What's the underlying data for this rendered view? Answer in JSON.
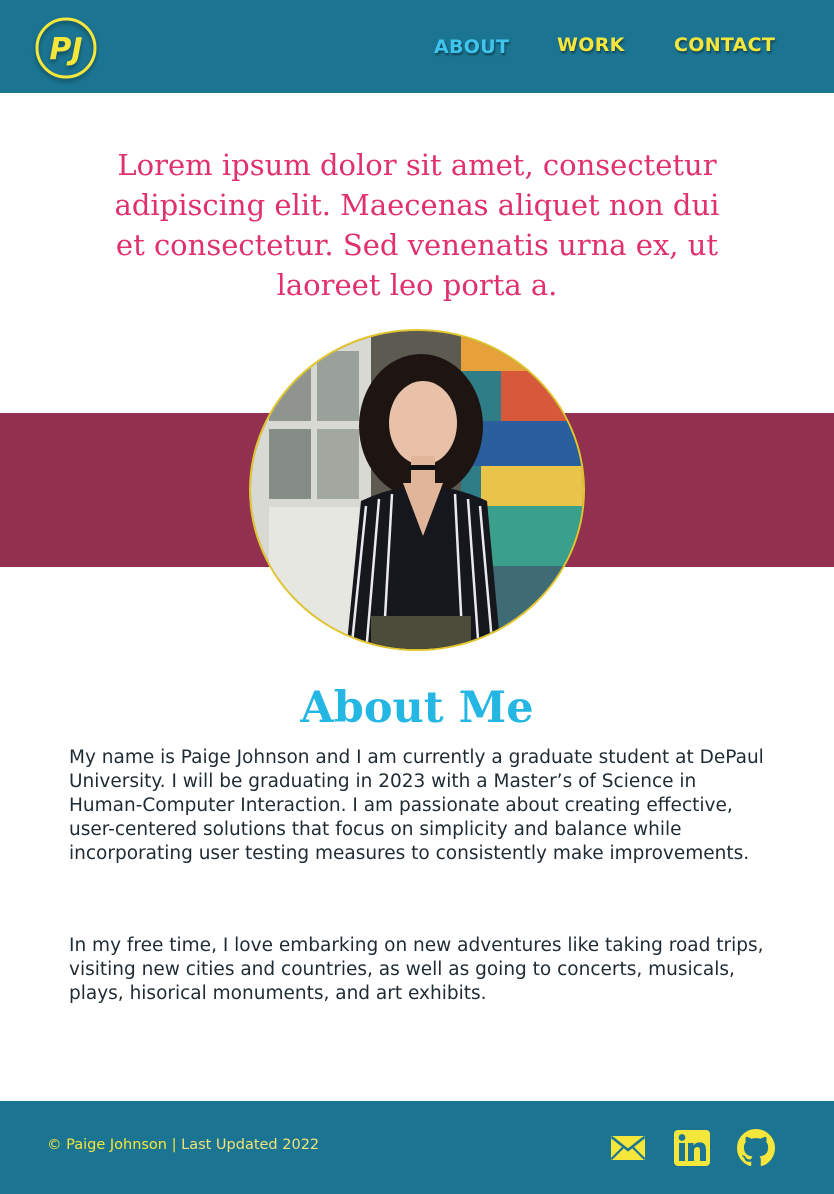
{
  "header": {
    "logo_text": "PJ",
    "nav": [
      {
        "label": "ABOUT",
        "active": true
      },
      {
        "label": "WORK",
        "active": false
      },
      {
        "label": "CONTACT",
        "active": false
      }
    ]
  },
  "hero": {
    "tagline": "Lorem ipsum dolor sit amet, consectetur adipiscing elit. Maecenas aliquet non dui et consectetur. Sed venenatis urna ex, ut laoreet leo porta a."
  },
  "about": {
    "title": "About Me",
    "paragraphs": [
      "My name is Paige Johnson and I am currently a graduate student at DePaul University. I will be graduating in 2023 with a Master’s of Science in Human-Computer Interaction. I am passionate about creating effective, user-centered solutions that focus on simplicity and balance while incorporating user testing measures to consistently make improvements.",
      "In my free time, I love embarking on new adventures like taking road trips, visiting new cities and countries, as well as going to concerts, musicals, plays, hisorical monuments, and art exhibits."
    ]
  },
  "footer": {
    "copyright_symbol": "©",
    "name": "Paige Johnson",
    "separator": "|",
    "updated": "Last Updated 2022",
    "social": [
      {
        "icon": "mail-icon"
      },
      {
        "icon": "linkedin-icon"
      },
      {
        "icon": "github-icon"
      }
    ]
  },
  "colors": {
    "header_bg": "#1b7592",
    "accent_yellow": "#f5e63c",
    "active_nav": "#3fc4ee",
    "tagline": "#e0306e",
    "band": "#91304f",
    "about_title": "#25b7e3"
  }
}
